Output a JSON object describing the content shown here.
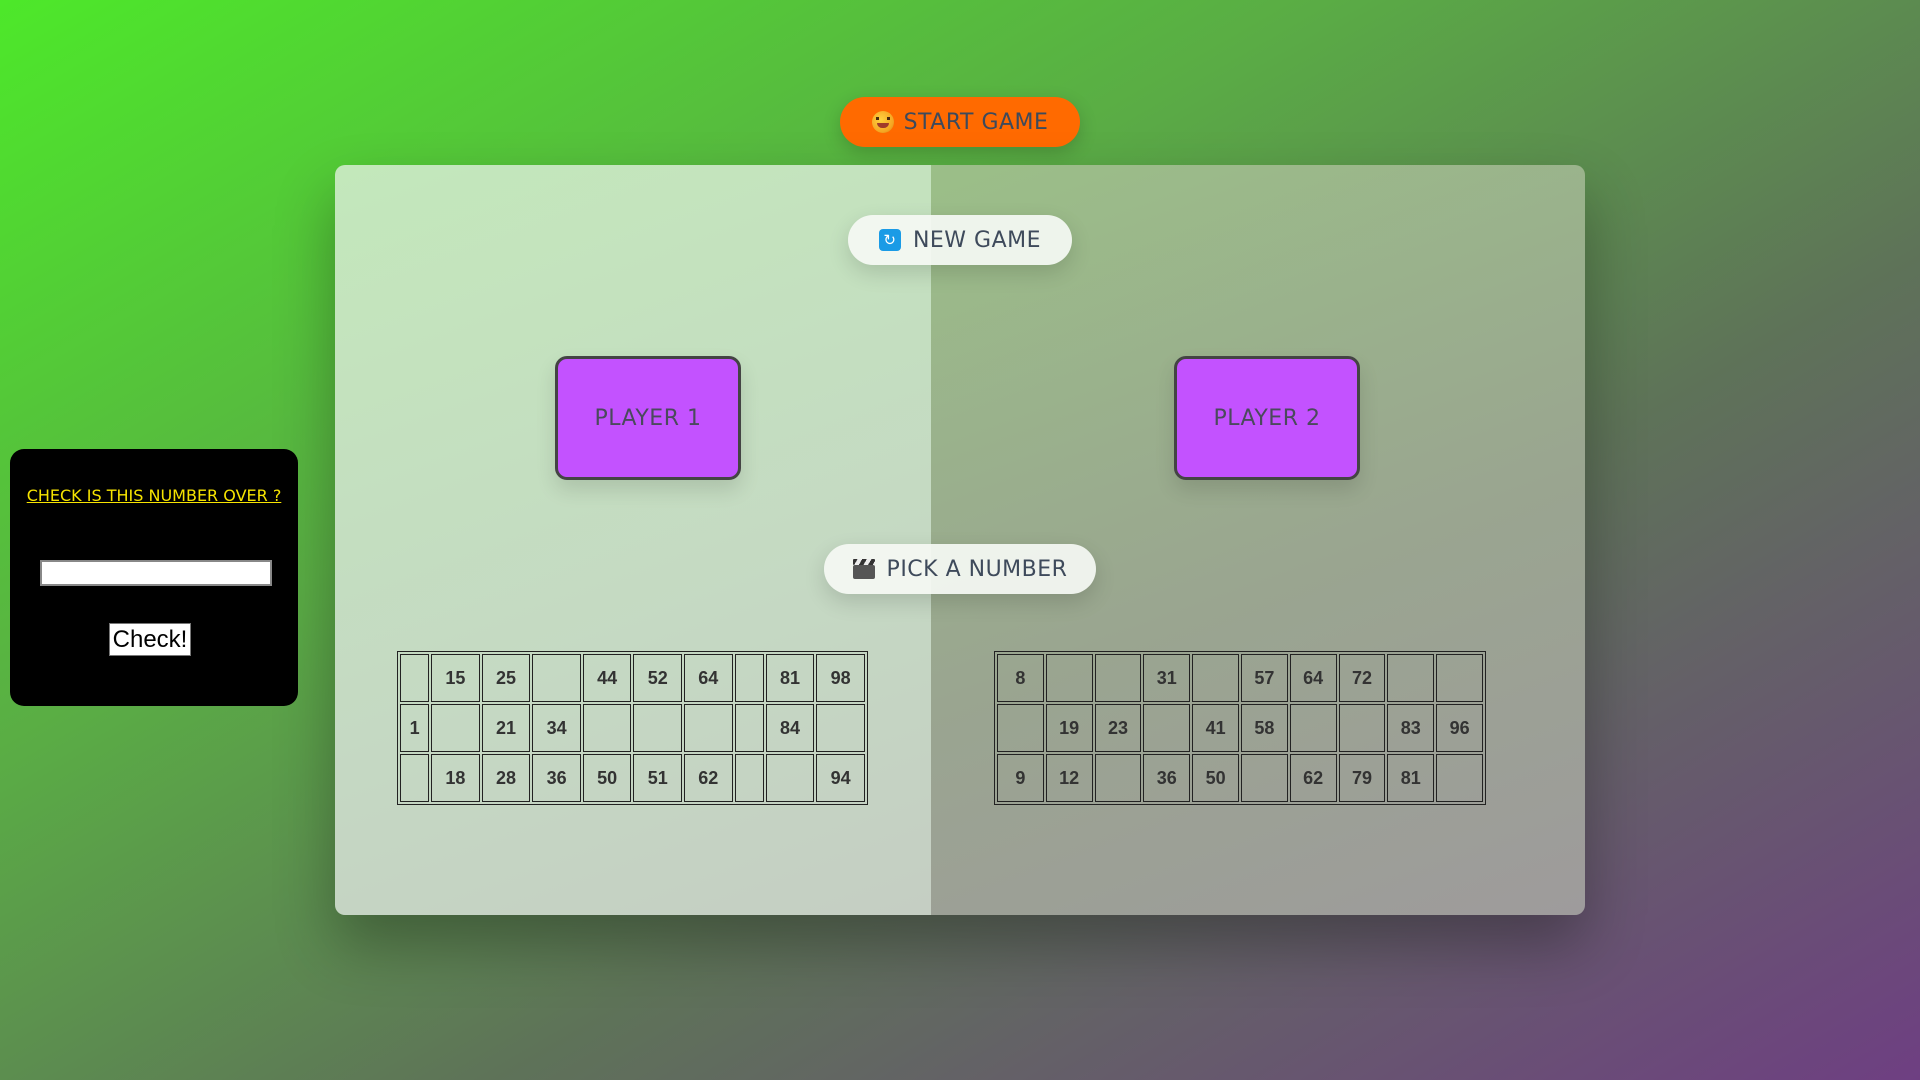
{
  "header": {
    "start_game_label": "START GAME",
    "start_game_icon": "party-face-emoji"
  },
  "board": {
    "new_game_label": "NEW GAME",
    "new_game_icon": "refresh-icon",
    "pick_number_label": "PICK A NUMBER",
    "pick_number_icon": "clapper-board-icon",
    "player1_label": "PLAYER 1",
    "player2_label": "PLAYER 2",
    "colors": {
      "start_button": "#ff6a00",
      "player_box": "#c352ff",
      "check_link": "#f7e400"
    }
  },
  "tickets": {
    "player1": [
      [
        "",
        "15",
        "25",
        "",
        "44",
        "52",
        "64",
        "",
        "81",
        "98"
      ],
      [
        "1",
        "",
        "21",
        "34",
        "",
        "",
        "",
        "",
        "84",
        ""
      ],
      [
        "",
        "18",
        "28",
        "36",
        "50",
        "51",
        "62",
        "",
        "",
        "94"
      ]
    ],
    "player2": [
      [
        "8",
        "",
        "",
        "31",
        "",
        "57",
        "64",
        "72",
        "",
        ""
      ],
      [
        "",
        "19",
        "23",
        "",
        "41",
        "58",
        "",
        "",
        "83",
        "96"
      ],
      [
        "9",
        "12",
        "",
        "36",
        "50",
        "",
        "62",
        "79",
        "81",
        ""
      ]
    ]
  },
  "checker": {
    "link_label": "CHECK IS THIS NUMBER OVER ?",
    "input_value": "",
    "button_label": "Check!"
  }
}
